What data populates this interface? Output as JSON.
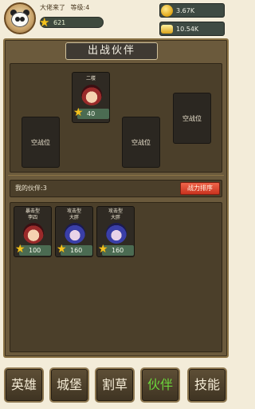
{
  "header": {
    "player_name": "大佬来了",
    "level_text": "等级:4",
    "power": "621",
    "gold": "3.67K",
    "ingot": "10.54K"
  },
  "panel": {
    "title": "出战伙伴",
    "battle_slots": [
      {
        "type": "empty",
        "label": "空战位"
      },
      {
        "type": "hero",
        "name": "二楼",
        "level": "40",
        "portrait": "red"
      },
      {
        "type": "empty",
        "label": "空战位"
      },
      {
        "type": "empty",
        "label": "空战位"
      }
    ],
    "my_partners_label": "我的伙伴:3",
    "sort_button": "战力排序",
    "partners": [
      {
        "role": "暴击型",
        "name": "李四",
        "level": "100",
        "portrait": "red"
      },
      {
        "role": "攻击型",
        "name": "大胖",
        "level": "160",
        "portrait": "blue"
      },
      {
        "role": "攻击型",
        "name": "大胖",
        "level": "160",
        "portrait": "blue"
      }
    ]
  },
  "nav": {
    "items": [
      {
        "label": "英雄",
        "active": false
      },
      {
        "label": "城堡",
        "active": false
      },
      {
        "label": "割草",
        "active": false
      },
      {
        "label": "伙伴",
        "active": true
      },
      {
        "label": "技能",
        "active": false
      }
    ]
  },
  "icons": {
    "avatar": "panda-avatar-icon",
    "power": "star-icon",
    "gold": "gold-coin-icon",
    "ingot": "gold-ingot-icon",
    "level_star": "star-icon"
  },
  "colors": {
    "active_nav_text": "#6cd43b",
    "sort_button": "#e04a30",
    "panel_bg": "#6b5a3c"
  }
}
